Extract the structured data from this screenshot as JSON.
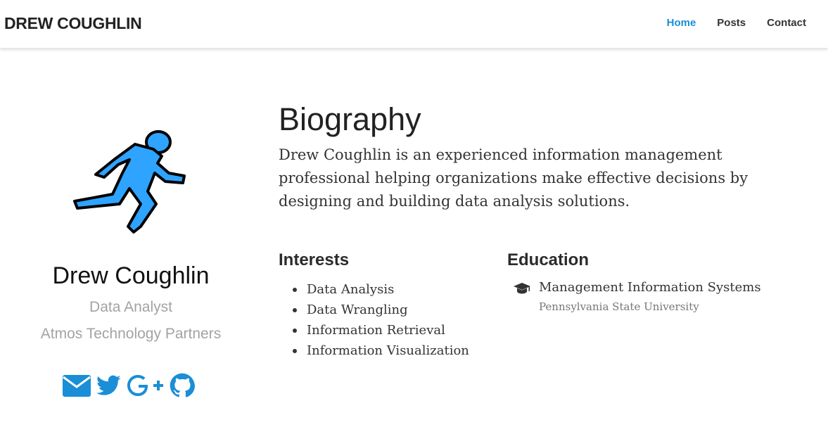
{
  "site": {
    "brand": "DREW COUGHLIN",
    "nav": [
      {
        "label": "Home",
        "active": true
      },
      {
        "label": "Posts",
        "active": false
      },
      {
        "label": "Contact",
        "active": false
      }
    ]
  },
  "profile": {
    "avatar_icon": "running-person-icon",
    "name": "Drew Coughlin",
    "role": "Data Analyst",
    "organization": "Atmos Technology Partners",
    "social": [
      {
        "icon": "envelope-icon"
      },
      {
        "icon": "twitter-icon"
      },
      {
        "icon": "google-plus-icon"
      },
      {
        "icon": "github-icon"
      }
    ]
  },
  "biography": {
    "title": "Biography",
    "text": "Drew Coughlin is an experienced information management professional helping organizations make effective decisions by designing and building data analysis solutions."
  },
  "interests": {
    "title": "Interests",
    "items": [
      "Data Analysis",
      "Data Wrangling",
      "Information Retrieval",
      "Information Visualization"
    ]
  },
  "education": {
    "title": "Education",
    "items": [
      {
        "icon": "graduation-cap-icon",
        "course": "Management Information Systems",
        "institution": "Pennsylvania State University"
      }
    ]
  },
  "colors": {
    "accent": "#1a8ed6",
    "avatar_fill": "#2ea3ff",
    "muted_text": "#a3a3a3"
  }
}
